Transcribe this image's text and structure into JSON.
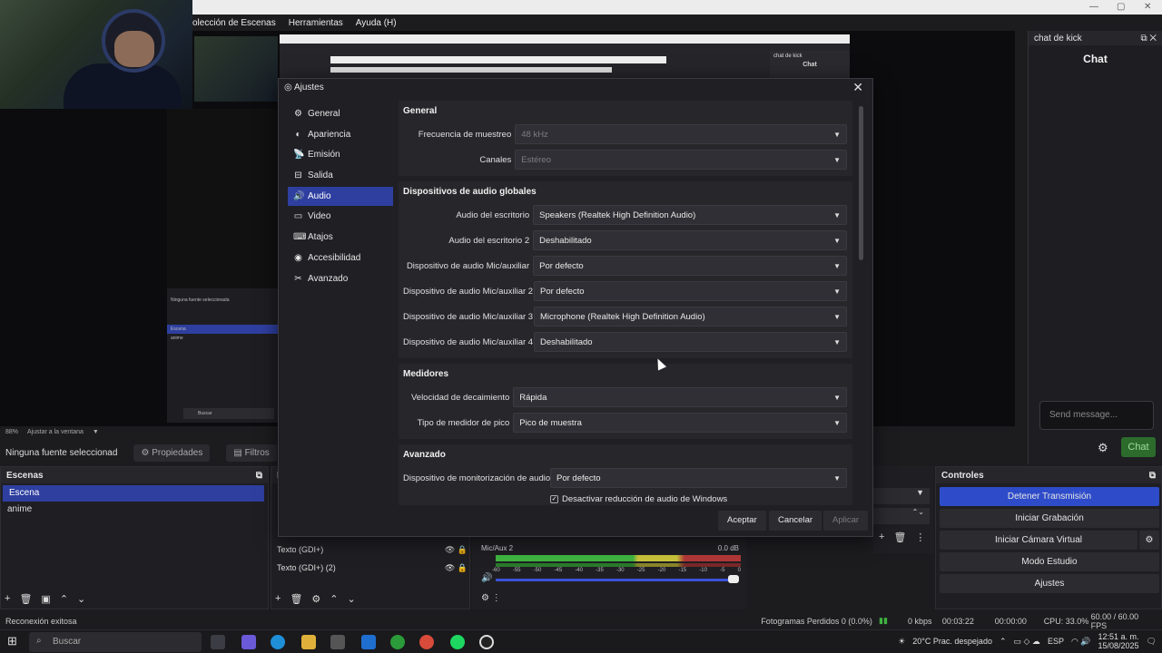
{
  "menubar": [
    "olección de Escenas",
    "Herramientas",
    "Ayuda (H)"
  ],
  "preview": {
    "zoom_label": "88%",
    "fit_label": "Ajustar a la ventana",
    "mini_scenes": [
      "Ninguna fuente seleccionada",
      "Escena",
      "anime"
    ],
    "mini_search": "Buscar",
    "nested_side_title": "chat de kick",
    "nested_side_chat": "Chat"
  },
  "source_bar": {
    "no_source": "Ninguna fuente seleccionad",
    "properties": "Propiedades",
    "filters": "Filtros"
  },
  "kick": {
    "dock_title": "chat de kick",
    "chat_title": "Chat",
    "message_placeholder": "Send message...",
    "chat_button": "Chat"
  },
  "scenes": {
    "title": "Escenas",
    "items": [
      "Escena",
      "anime"
    ]
  },
  "sources": {
    "title": "F",
    "items": [
      "Texto (GDI+)",
      "Texto (GDI+) (2)"
    ]
  },
  "mixer": {
    "channel": "Mic/Aux 2",
    "level": "0.0 dB",
    "ticks": [
      "-60",
      "-55",
      "-50",
      "-45",
      "-40",
      "-35",
      "-30",
      "-25",
      "-20",
      "-15",
      "-10",
      "-5",
      "0"
    ]
  },
  "controls": {
    "title": "Controles",
    "buttons": [
      "Detener Transmisión",
      "Iniciar Grabación",
      "Iniciar Cámara Virtual",
      "Modo Estudio",
      "Ajustes"
    ]
  },
  "dialog": {
    "title": "Ajustes",
    "nav": [
      {
        "label": "General",
        "icon": "gear-icon",
        "glyph": "⚙"
      },
      {
        "label": "Apariencia",
        "icon": "appearance-icon",
        "glyph": "◐"
      },
      {
        "label": "Emisión",
        "icon": "broadcast-icon",
        "glyph": "📡"
      },
      {
        "label": "Salida",
        "icon": "output-icon",
        "glyph": "⊟"
      },
      {
        "label": "Audio",
        "icon": "speaker-icon",
        "glyph": "🔊"
      },
      {
        "label": "Video",
        "icon": "monitor-icon",
        "glyph": "▭"
      },
      {
        "label": "Atajos",
        "icon": "keyboard-icon",
        "glyph": "⌨"
      },
      {
        "label": "Accesibilidad",
        "icon": "accessibility-icon",
        "glyph": "◉"
      },
      {
        "label": "Avanzado",
        "icon": "wrench-icon",
        "glyph": "✂"
      }
    ],
    "selected_nav": "Audio",
    "general": {
      "title": "General",
      "sample_rate_label": "Frecuencia de muestreo",
      "sample_rate_value": "48 kHz",
      "channels_label": "Canales",
      "channels_value": "Estéreo"
    },
    "global_devices": {
      "title": "Dispositivos de audio globales",
      "rows": [
        {
          "label": "Audio del escritorio",
          "value": "Speakers (Realtek High Definition Audio)"
        },
        {
          "label": "Audio del escritorio 2",
          "value": "Deshabilitado"
        },
        {
          "label": "Dispositivo de audio Mic/auxiliar",
          "value": "Por defecto"
        },
        {
          "label": "Dispositivo de audio Mic/auxiliar 2",
          "value": "Por defecto"
        },
        {
          "label": "Dispositivo de audio Mic/auxiliar 3",
          "value": "Microphone (Realtek High Definition Audio)"
        },
        {
          "label": "Dispositivo de audio Mic/auxiliar 4",
          "value": "Deshabilitado"
        }
      ]
    },
    "meters": {
      "title": "Medidores",
      "decay_label": "Velocidad de decaimiento",
      "decay_value": "Rápida",
      "peak_label": "Tipo de medidor de pico",
      "peak_value": "Pico de muestra"
    },
    "advanced": {
      "title": "Avanzado",
      "monitor_label": "Dispositivo de monitorización de audio",
      "monitor_value": "Por defecto",
      "ducking_label": "Desactivar reducción de audio de Windows"
    },
    "buttons": {
      "accept": "Aceptar",
      "cancel": "Cancelar",
      "apply": "Aplicar"
    }
  },
  "status": {
    "message": "Reconexión exitosa",
    "dropped": "Fotogramas Perdidos 0 (0.0%)",
    "kbps": "0 kbps",
    "stream_time": "00:03:22",
    "rec_time": "00:00:00",
    "cpu": "CPU: 33.0%",
    "fps": "60.00 / 60.00 FPS"
  },
  "taskbar": {
    "search_placeholder": "Buscar",
    "weather": "20°C  Prac. despejado",
    "lang": "ESP",
    "time": "12:51 a. m.",
    "date": "15/08/2025"
  }
}
